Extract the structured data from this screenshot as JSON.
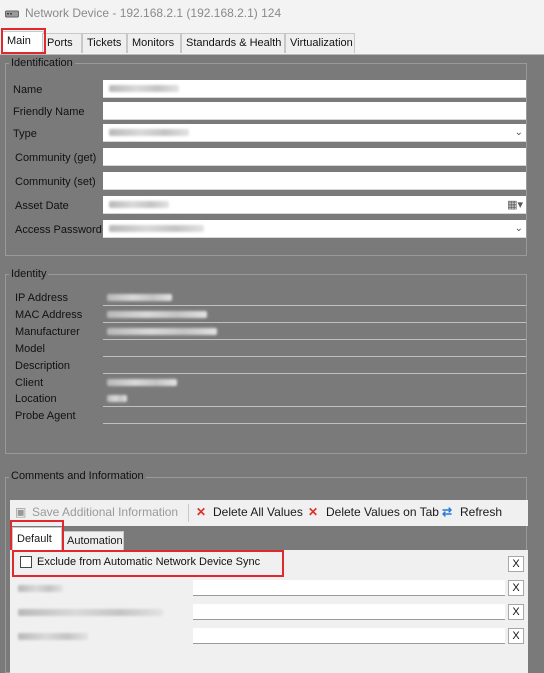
{
  "window": {
    "title": "Network Device - 192.168.2.1 (192.168.2.1) 124",
    "icon": "network-device-icon"
  },
  "tabs": [
    {
      "label": "Main",
      "active": true
    },
    {
      "label": "Ports"
    },
    {
      "label": "Tickets"
    },
    {
      "label": "Monitors"
    },
    {
      "label": "Standards & Health"
    },
    {
      "label": "Virtualization"
    }
  ],
  "identification": {
    "legend": "Identification",
    "fields": [
      {
        "label": "Name"
      },
      {
        "label": "Friendly Name"
      },
      {
        "label": "Type"
      },
      {
        "label": "Community (get)"
      },
      {
        "label": "Community (set)"
      },
      {
        "label": "Asset Date"
      },
      {
        "label": "Access Password"
      }
    ]
  },
  "identity": {
    "legend": "Identity",
    "fields": [
      {
        "label": "IP Address"
      },
      {
        "label": "MAC Address"
      },
      {
        "label": "Manufacturer"
      },
      {
        "label": "Model"
      },
      {
        "label": "Description"
      },
      {
        "label": "Client"
      },
      {
        "label": "Location"
      },
      {
        "label": "Probe Agent"
      }
    ]
  },
  "comments": {
    "legend": "Comments and Information",
    "toolbar": {
      "save": "Save Additional Information",
      "delete_all": "Delete All Values",
      "delete_tab": "Delete Values on Tab",
      "refresh": "Refresh"
    },
    "subtabs": [
      {
        "label": "Default",
        "active": true
      },
      {
        "label": "Automation"
      }
    ],
    "exclude_checkbox": {
      "label": "Exclude from Automatic Network Device Sync",
      "checked": false
    },
    "clear_button_label": "X"
  },
  "colors": {
    "highlight": "#e0292f",
    "background": "#7a7a7a",
    "delete_icon": "#d9302a",
    "refresh_icon": "#2b7bd6"
  }
}
